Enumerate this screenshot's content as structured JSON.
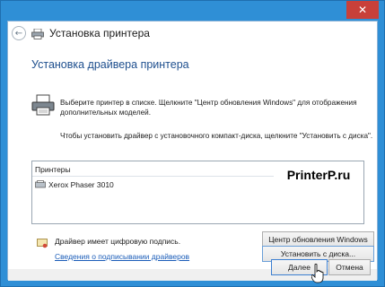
{
  "window": {
    "close_glyph": "✕",
    "title": "Установка принтера",
    "back_glyph": "←"
  },
  "content": {
    "heading": "Установка драйвера принтера",
    "para1": "Выберите принтер в списке. Щелкните \"Центр обновления Windows\" для отображения дополнительных моделей.",
    "para2": "Чтобы установить драйвер с установочного компакт-диска, щелкните \"Установить с диска\"."
  },
  "printer_list": {
    "header": "Принтеры",
    "items": [
      "Xerox Phaser 3010"
    ]
  },
  "watermark": "PrinterP.ru",
  "signature": {
    "status_text": "Драйвер имеет цифровую подпись.",
    "link_text": "Сведения о подписывании драйверов"
  },
  "buttons": {
    "windows_update": "Центр обновления Windows",
    "have_disk": "Установить с диска...",
    "next": "Далее",
    "cancel": "Отмена"
  },
  "colors": {
    "accent": "#2f8fd6",
    "heading": "#1e4f8e",
    "link": "#1a5cb8",
    "close": "#c8403a"
  },
  "icons": {
    "back": "back-arrow-icon",
    "title": "printer-icon",
    "main": "printer-icon",
    "list_item": "printer-icon",
    "signature": "certificate-icon",
    "pointer": "mouse-pointer-icon"
  }
}
